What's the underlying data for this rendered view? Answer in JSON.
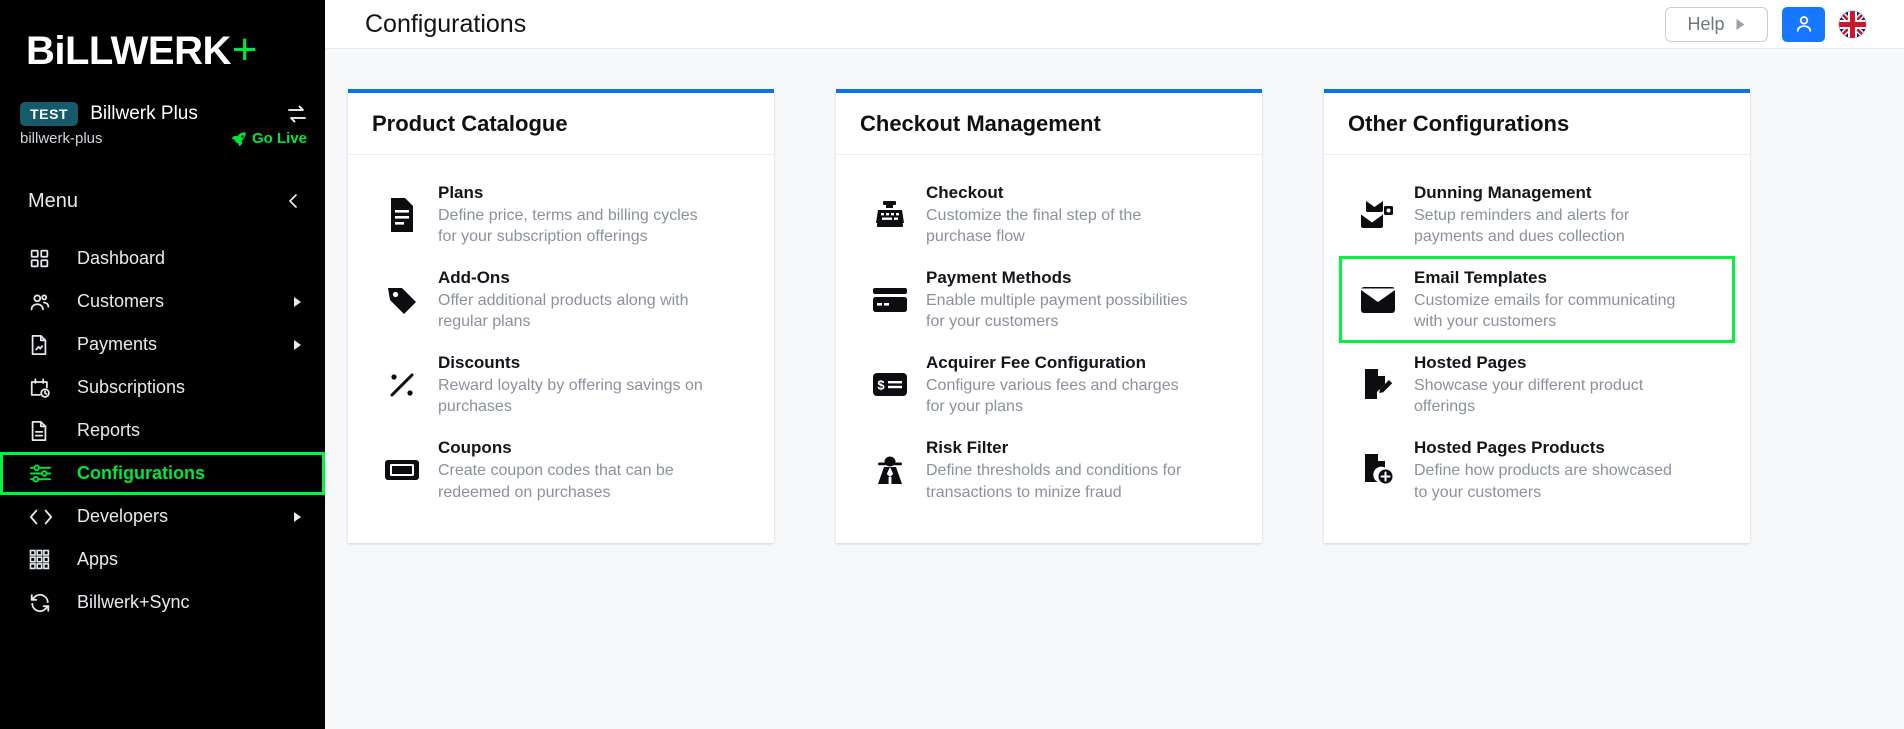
{
  "brand": {
    "name_main": "BiLLWERK",
    "name_plus": "+"
  },
  "account": {
    "badge": "TEST",
    "name": "Billwerk Plus",
    "slug": "billwerk-plus",
    "go_live": "Go Live",
    "switch_icon": "switch-account-icon"
  },
  "sidebar": {
    "menu_label": "Menu",
    "collapse_icon": "chevron-left-icon",
    "items": [
      {
        "label": "Dashboard",
        "icon": "grid-icon",
        "active": false,
        "has_submenu": false
      },
      {
        "label": "Customers",
        "icon": "users-icon",
        "active": false,
        "has_submenu": true
      },
      {
        "label": "Payments",
        "icon": "document-chart-icon",
        "active": false,
        "has_submenu": true
      },
      {
        "label": "Subscriptions",
        "icon": "calendar-clock-icon",
        "active": false,
        "has_submenu": false
      },
      {
        "label": "Reports",
        "icon": "report-document-icon",
        "active": false,
        "has_submenu": false
      },
      {
        "label": "Configurations",
        "icon": "sliders-icon",
        "active": true,
        "has_submenu": false
      },
      {
        "label": "Developers",
        "icon": "code-brackets-icon",
        "active": false,
        "has_submenu": true
      },
      {
        "label": "Apps",
        "icon": "apps-grid-icon",
        "active": false,
        "has_submenu": false
      },
      {
        "label": "Billwerk+Sync",
        "icon": "sync-refresh-icon",
        "active": false,
        "has_submenu": false
      }
    ]
  },
  "topbar": {
    "title": "Configurations",
    "help_label": "Help",
    "help_caret_icon": "triangle-right-icon",
    "user_icon": "user-avatar-icon",
    "language_flag": "uk-flag-icon"
  },
  "cards": [
    {
      "title": "Product Catalogue",
      "items": [
        {
          "title": "Plans",
          "desc": "Define price, terms and billing cycles for your subscription offerings",
          "icon": "plans-document-icon",
          "highlighted": false
        },
        {
          "title": "Add-Ons",
          "desc": "Offer additional products along with regular plans",
          "icon": "tag-icon",
          "highlighted": false
        },
        {
          "title": "Discounts",
          "desc": "Reward loyalty by offering savings on purchases",
          "icon": "percent-icon",
          "highlighted": false
        },
        {
          "title": "Coupons",
          "desc": "Create coupon codes that can be redeemed on purchases",
          "icon": "ticket-icon",
          "highlighted": false
        }
      ]
    },
    {
      "title": "Checkout Management",
      "items": [
        {
          "title": "Checkout",
          "desc": "Customize the final step of the purchase flow",
          "icon": "cash-register-icon",
          "highlighted": false
        },
        {
          "title": "Payment Methods",
          "desc": "Enable multiple payment possibilities for your customers",
          "icon": "credit-card-icon",
          "highlighted": false
        },
        {
          "title": "Acquirer Fee Configuration",
          "desc": "Configure various fees and charges for your plans",
          "icon": "dollar-card-icon",
          "highlighted": false
        },
        {
          "title": "Risk Filter",
          "desc": "Define thresholds and conditions for transactions to minize fraud",
          "icon": "spy-detective-icon",
          "highlighted": false
        }
      ]
    },
    {
      "title": "Other Configurations",
      "items": [
        {
          "title": "Dunning Management",
          "desc": "Setup reminders and alerts for payments and dues collection",
          "icon": "dunning-mail-stack-icon",
          "highlighted": false
        },
        {
          "title": "Email Templates",
          "desc": "Customize emails for communicating with your customers",
          "icon": "envelope-icon",
          "highlighted": true
        },
        {
          "title": "Hosted Pages",
          "desc": "Showcase your different product offerings",
          "icon": "document-edit-icon",
          "highlighted": false
        },
        {
          "title": "Hosted Pages Products",
          "desc": "Define how products are showcased to your customers",
          "icon": "document-add-icon",
          "highlighted": false
        }
      ]
    }
  ],
  "colors": {
    "brand_green": "#00E63C",
    "highlight_green": "#00F53C",
    "card_accent_blue": "#0A74F0",
    "sidebar_bg": "#000000",
    "badge_teal": "#165A6B",
    "user_button_blue": "#1677ff"
  }
}
